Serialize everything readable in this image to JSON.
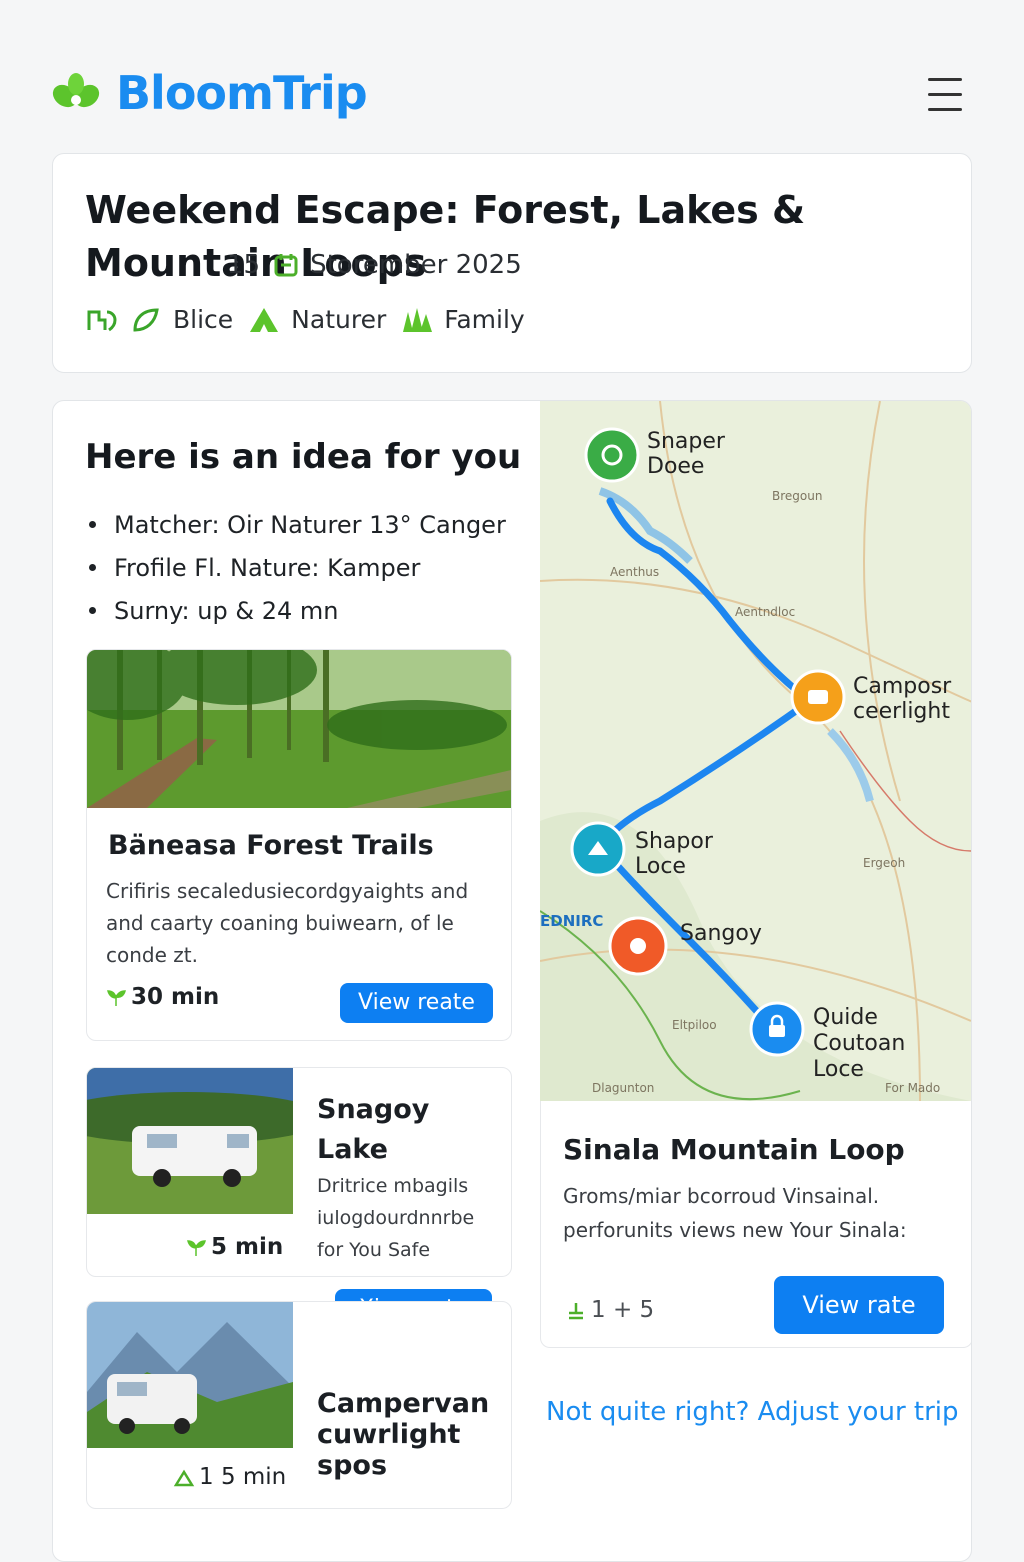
{
  "app": {
    "name": "BloomTrip"
  },
  "trip": {
    "title": "Weekend Escape: Forest, Lakes & Mountain Loops",
    "day": "15",
    "month": "Storember 2025",
    "tags": [
      {
        "label": "Blice",
        "icon": "bike-icon"
      },
      {
        "label": "Naturer",
        "icon": "tent-icon"
      },
      {
        "label": "Family",
        "icon": "grass-icon"
      }
    ]
  },
  "idea": {
    "heading": "Here is an idea for you",
    "bullets": [
      "Matcher: Oir Naturer 13°  Canger",
      "Frofile  Fl.  Nature:  Kamper",
      "Surny: up & 24 mn"
    ]
  },
  "cards": [
    {
      "title": "Bäneasa Forest Trails",
      "description": "Crifiris secaledusiecordgyaights and and caarty coaning buiwearn, of le conde zt.",
      "duration": "30 min",
      "button": "View reate"
    },
    {
      "title": "Snagoy Lake",
      "description": "Dritrice mbagils iulogdourdnnrbe for You Safe",
      "duration": "5 min",
      "button": "Xiew nate"
    },
    {
      "title": "Campervan cuwrlight spos",
      "duration": "1 5 min"
    }
  ],
  "map": {
    "pins": [
      {
        "label": "Snaper Doee",
        "color": "#3aac46",
        "icon": "search-icon"
      },
      {
        "label": "Camposr ceerlight",
        "color": "#f5a01a",
        "icon": "camper-icon"
      },
      {
        "label": "Shapor Loce",
        "color": "#18a8c8",
        "icon": "cabin-icon"
      },
      {
        "label": "Sangoy",
        "color": "#f05a28",
        "icon": "pin-icon"
      },
      {
        "label": "Quide Coutoan Loce",
        "color": "#1a8cf0",
        "icon": "lock-icon"
      }
    ],
    "places": [
      "Bregoun",
      "Aenthus",
      "Aentndloc",
      "Ergeoh",
      "EDNIRC",
      "Eltpiloo",
      "Dlagunton",
      "For Mado"
    ]
  },
  "mountain": {
    "title": "Sinala Mountain Loop",
    "description": "Groms/miar bcorroud Vinsainal. perforunits views new Your Sinala:",
    "stats": "1 + 5",
    "button": "View rate"
  },
  "adjust_link": "Not quite right? Adjust your trip",
  "colors": {
    "brand": "#1a8cf0",
    "accent_green": "#5cc42c",
    "button": "#0d7ff2",
    "route": "#1d86f0"
  }
}
